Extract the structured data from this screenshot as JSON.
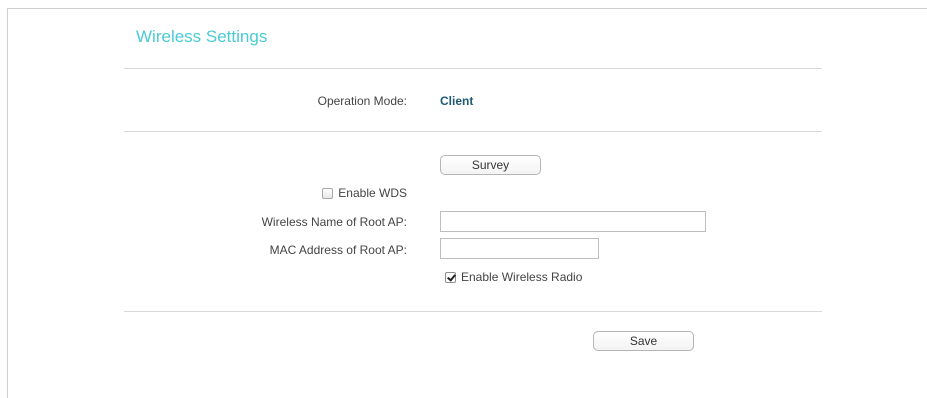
{
  "header": {
    "title": "Wireless Settings"
  },
  "operation_mode": {
    "label": "Operation Mode:",
    "value": "Client"
  },
  "survey_button": {
    "label": "Survey"
  },
  "enable_wds": {
    "label": "Enable WDS",
    "checked": false
  },
  "root_ap_name": {
    "label": "Wireless Name of Root AP:",
    "value": ""
  },
  "root_ap_mac": {
    "label": "MAC Address of Root AP:",
    "value": ""
  },
  "enable_radio": {
    "label": "Enable Wireless Radio",
    "checked": true
  },
  "save_button": {
    "label": "Save"
  },
  "colors": {
    "title": "#4acbd6",
    "value_text": "#1f5a73",
    "divider": "#d9d9d9"
  }
}
